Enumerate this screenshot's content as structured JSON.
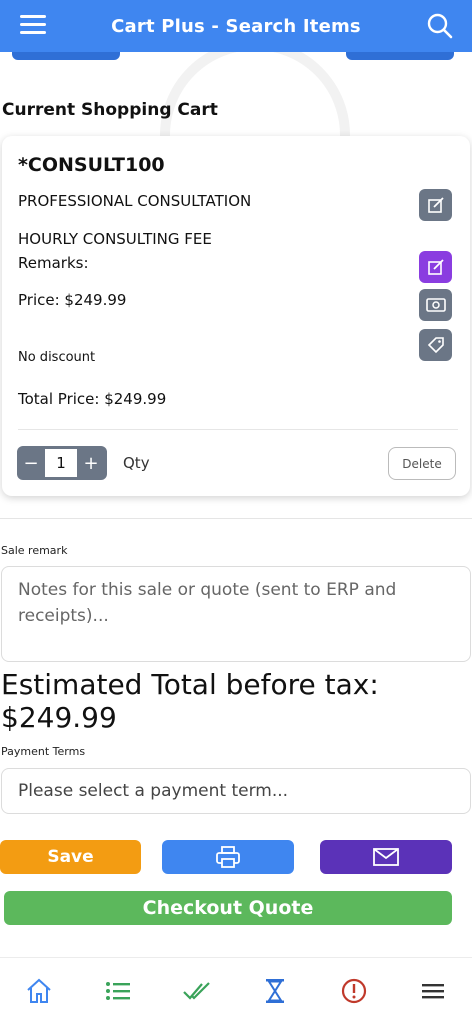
{
  "header": {
    "title": "Cart Plus - Search Items",
    "menu_icon": "hamburger-icon",
    "search_icon": "search-icon",
    "bar_color": "#3f86f0"
  },
  "cart": {
    "section_title": "Current Shopping Cart",
    "item": {
      "code": "*CONSULT100",
      "name": "PROFESSIONAL CONSULTATION",
      "description": "HOURLY CONSULTING FEE",
      "remarks_label": "Remarks:",
      "price": "Price: $249.99",
      "discount": "No discount",
      "total_price": "Total Price: $249.99",
      "quantity": "1",
      "qty_label": "Qty",
      "minus_label": "−",
      "plus_label": "+",
      "delete_label": "Delete",
      "action_icons": [
        "edit-icon",
        "edit-remarks-icon",
        "price-icon",
        "tag-icon"
      ]
    }
  },
  "sale_remark": {
    "label": "Sale remark",
    "placeholder": "Notes for this sale or quote (sent to ERP and receipts)..."
  },
  "estimated_total": {
    "label": "Estimated Total before tax:",
    "value": "$249.99"
  },
  "payment_terms": {
    "label": "Payment Terms",
    "placeholder": "Please select a payment term..."
  },
  "actions": {
    "save_label": "Save",
    "print_icon": "printer-icon",
    "email_icon": "envelope-icon",
    "checkout_label": "Checkout Quote",
    "colors": {
      "save": "#f39c12",
      "print": "#3f86f0",
      "email": "#5b32b8",
      "checkout": "#5cb85c"
    }
  },
  "bottom_nav": {
    "items": [
      "home-icon",
      "list-icon",
      "double-check-icon",
      "hourglass-icon",
      "alert-icon",
      "menu-icon"
    ]
  }
}
